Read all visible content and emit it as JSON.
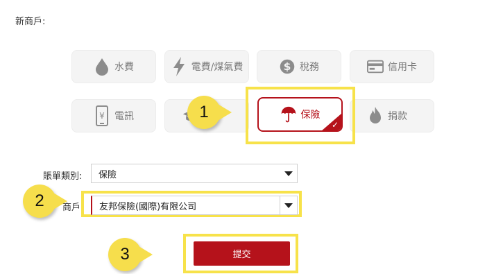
{
  "page": {
    "title": "新商戶:"
  },
  "categories": [
    {
      "label": "水費",
      "icon": "water-drop-icon"
    },
    {
      "label": "電費/煤氣費",
      "icon": "lightning-icon"
    },
    {
      "label": "稅務",
      "icon": "dollar-globe-icon"
    },
    {
      "label": "信用卡",
      "icon": "credit-card-icon"
    },
    {
      "label": "電訊",
      "icon": "phone-yen-icon"
    },
    {
      "label": "",
      "icon": "graduation-cap-icon"
    },
    {
      "label": "保險",
      "icon": "umbrella-icon",
      "selected": true
    },
    {
      "label": "捐款",
      "icon": "flame-icon"
    }
  ],
  "form": {
    "bill_type_label": "賬單類別:",
    "bill_type_value": "保險",
    "merchant_label": "商戶",
    "merchant_value": "友邦保險(國際)有限公司"
  },
  "submit_label": "提交",
  "callouts": [
    "1",
    "2",
    "3"
  ],
  "colors": {
    "accent": "#b5121b",
    "highlight": "#f7e24a",
    "callout": "#f6de4c"
  }
}
